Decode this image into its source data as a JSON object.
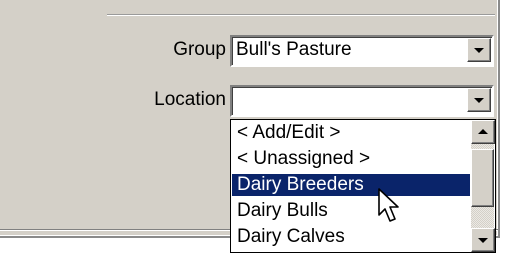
{
  "form": {
    "group": {
      "label": "Group",
      "value": "Bull's Pasture"
    },
    "location": {
      "label": "Location",
      "value": ""
    }
  },
  "location_dropdown": {
    "items": [
      {
        "label": "< Add/Edit >"
      },
      {
        "label": "< Unassigned >"
      },
      {
        "label": "Dairy Breeders",
        "selected": true
      },
      {
        "label": "Dairy Bulls"
      },
      {
        "label": "Dairy Calves"
      }
    ],
    "selected_color": "#0a246a"
  },
  "icons": [
    "chevron-down-icon",
    "scroll-up-icon",
    "scroll-down-icon",
    "mouse-pointer-icon"
  ]
}
